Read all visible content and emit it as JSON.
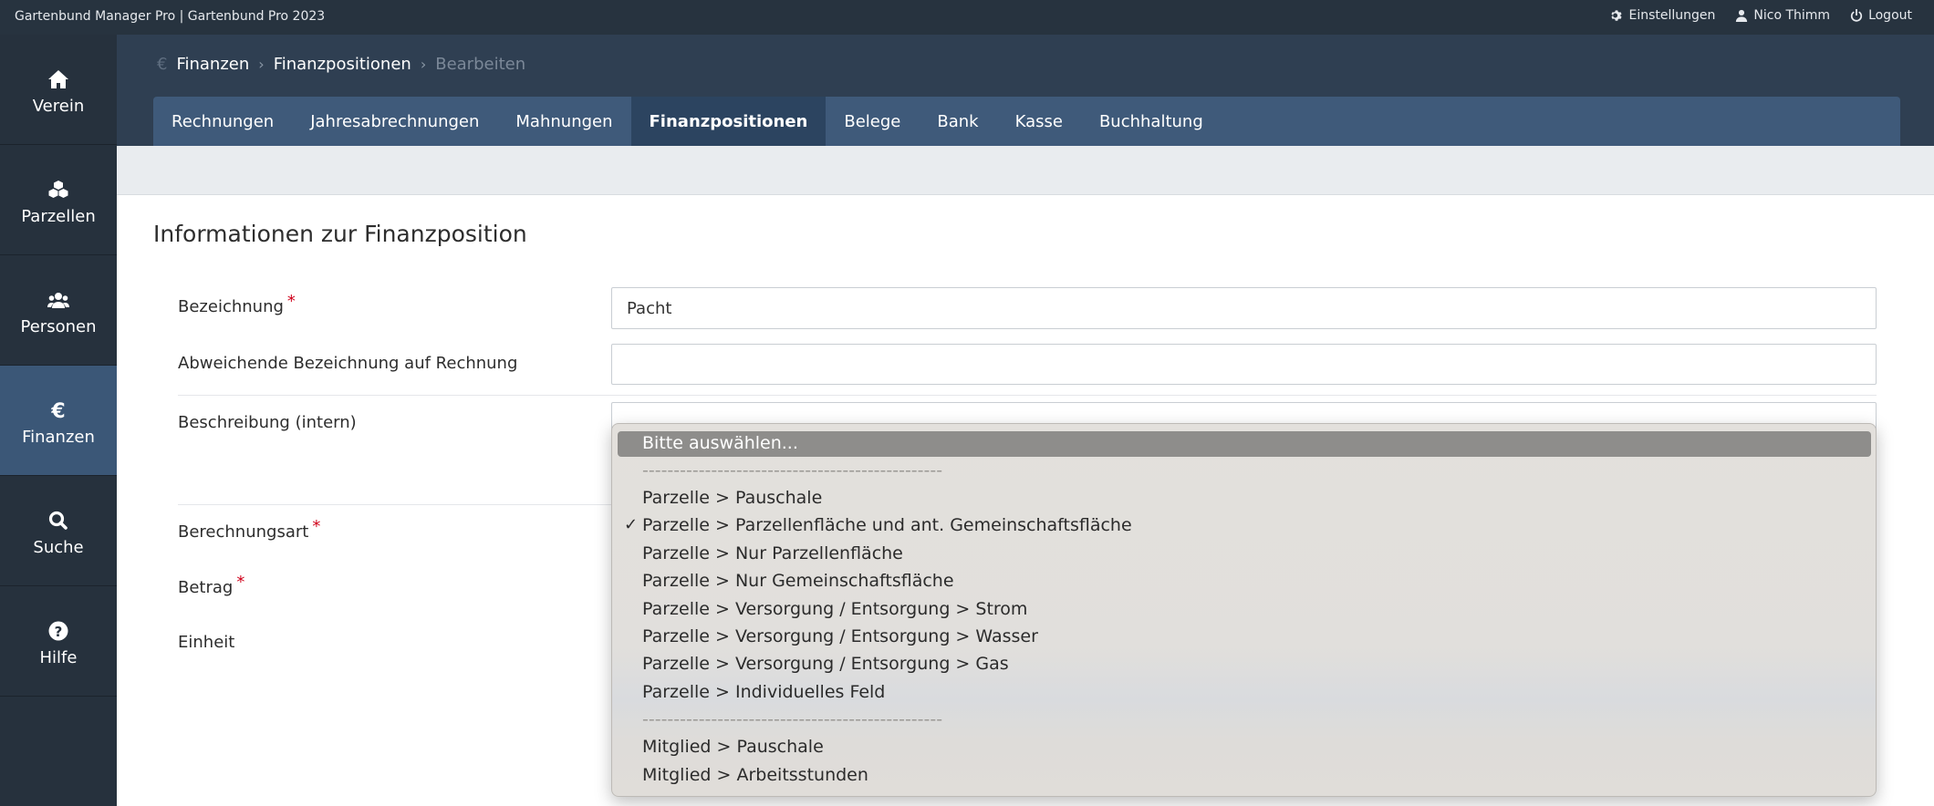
{
  "app_title": "Gartenbund Manager Pro | Gartenbund Pro 2023",
  "topbar": {
    "settings": "Einstellungen",
    "user": "Nico Thimm",
    "logout": "Logout"
  },
  "sidebar": {
    "items": [
      {
        "label": "Verein",
        "icon": "home-icon"
      },
      {
        "label": "Parzellen",
        "icon": "parcels-icon"
      },
      {
        "label": "Personen",
        "icon": "users-icon"
      },
      {
        "label": "Finanzen",
        "icon": "euro-icon"
      },
      {
        "label": "Suche",
        "icon": "search-icon"
      },
      {
        "label": "Hilfe",
        "icon": "help-icon"
      }
    ]
  },
  "breadcrumb": {
    "icon": "€",
    "items": [
      "Finanzen",
      "Finanzpositionen",
      "Bearbeiten"
    ]
  },
  "tabs": [
    "Rechnungen",
    "Jahresabrechnungen",
    "Mahnungen",
    "Finanzpositionen",
    "Belege",
    "Bank",
    "Kasse",
    "Buchhaltung"
  ],
  "form": {
    "title": "Informationen zur Finanzposition",
    "bezeichnung_label": "Bezeichnung",
    "bezeichnung_value": "Pacht",
    "abweichende_label": "Abweichende Bezeichnung auf Rechnung",
    "abweichende_value": "",
    "beschreibung_label": "Beschreibung (intern)",
    "berechnungsart_label": "Berechnungsart",
    "betrag_label": "Betrag",
    "einheit_label": "Einheit",
    "required_mark": "*"
  },
  "dropdown": {
    "options": [
      "Bitte auswählen...",
      "------------------------------------------------",
      "Parzelle > Pauschale",
      "Parzelle > Parzellenfläche und ant. Gemeinschaftsfläche",
      "Parzelle > Nur Parzellenfläche",
      "Parzelle > Nur Gemeinschaftsfläche",
      "Parzelle > Versorgung / Entsorgung > Strom",
      "Parzelle > Versorgung / Entsorgung > Wasser",
      "Parzelle > Versorgung / Entsorgung > Gas",
      "Parzelle > Individuelles Feld",
      "------------------------------------------------",
      "Mitglied > Pauschale",
      "Mitglied > Arbeitsstunden"
    ],
    "checkmark": "✓"
  },
  "colors": {
    "topbar": "#27333f",
    "sidebar": "#26313d",
    "sidebar_active": "#3b5777",
    "tabs_bg": "#3f5a7a",
    "tab_active": "#2c4460",
    "required": "#d0021b"
  }
}
